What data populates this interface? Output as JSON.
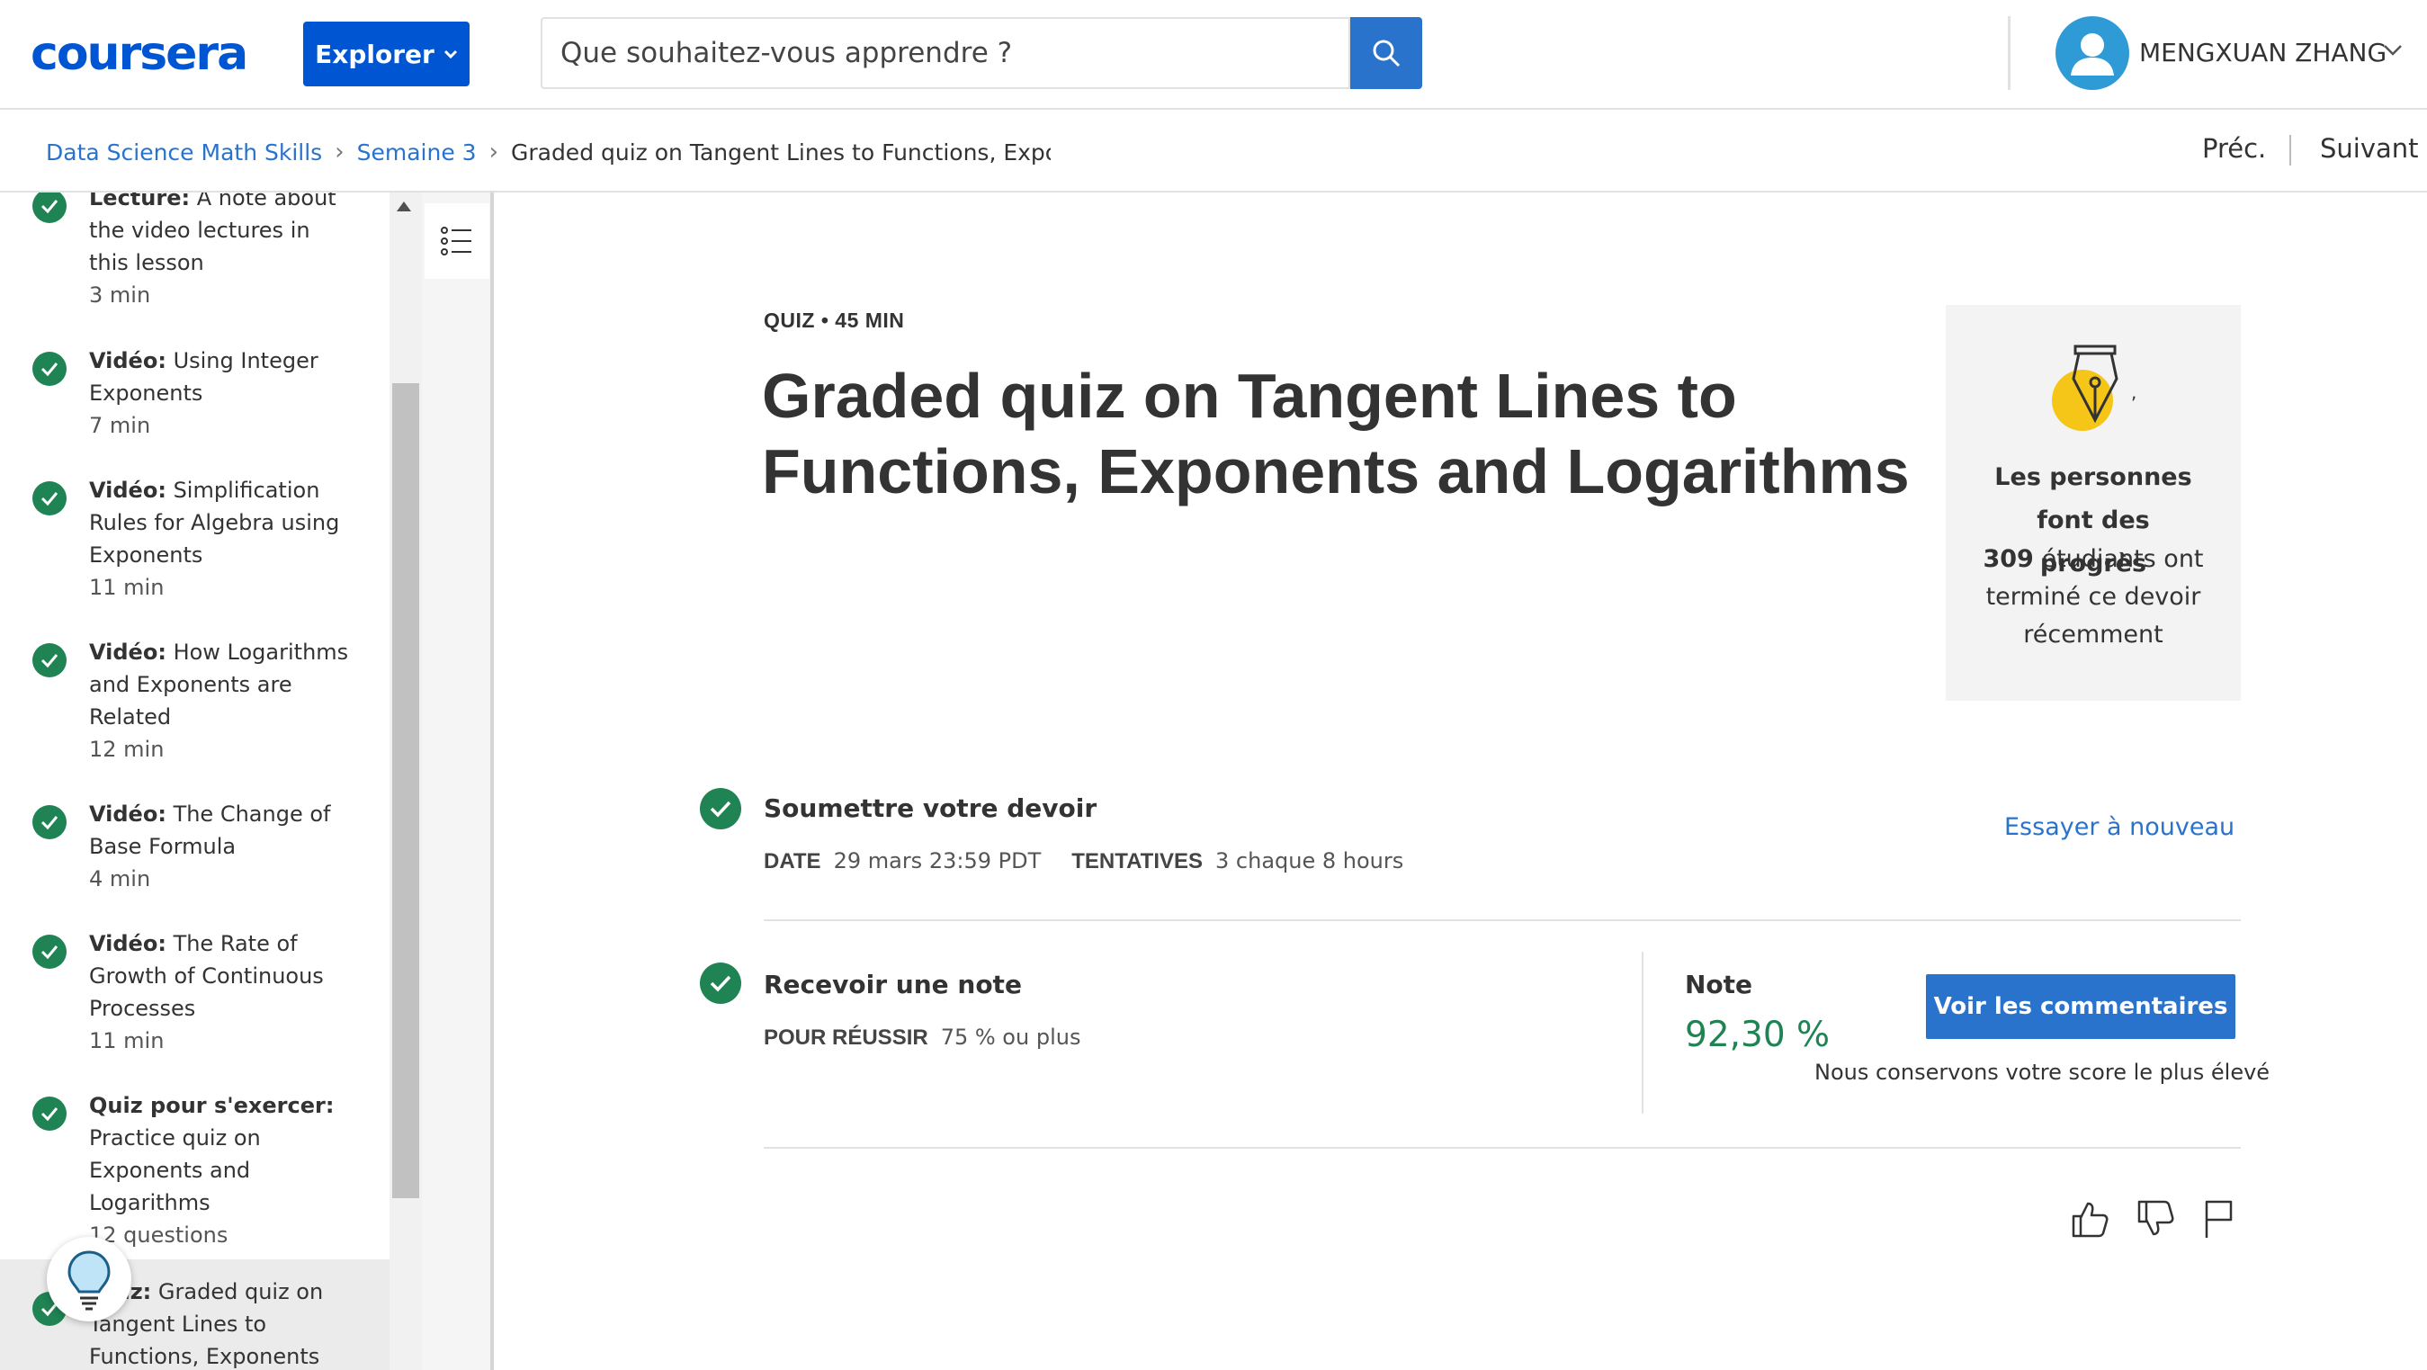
{
  "header": {
    "logo": "coursera",
    "explore_label": "Explorer",
    "search": {
      "placeholder": "Que souhaitez-vous apprendre ?"
    },
    "user_name": "MENGXUAN ZHANG"
  },
  "breadcrumb": {
    "items": [
      "Data Science Math Skills",
      "Semaine 3"
    ],
    "current": "Graded quiz on Tangent Lines to Functions, Exponents and Logarithms",
    "prev_label": "Préc.",
    "next_label": "Suivant"
  },
  "sidebar": {
    "items": [
      {
        "type": "Lecture:",
        "title": "A note about the video lectures in this lesson",
        "duration": "3  min"
      },
      {
        "type": "Vidéo:",
        "title": "Using Integer Exponents",
        "duration": "7  min"
      },
      {
        "type": "Vidéo:",
        "title": "Simplification Rules for Algebra using Exponents",
        "duration": "11  min"
      },
      {
        "type": "Vidéo:",
        "title": "How Logarithms and Exponents are Related",
        "duration": "12  min"
      },
      {
        "type": "Vidéo:",
        "title": "The Change of Base Formula",
        "duration": "4  min"
      },
      {
        "type": "Vidéo:",
        "title": "The Rate of Growth of Continuous Processes",
        "duration": "11  min"
      },
      {
        "type": "Quiz pour s'exercer:",
        "title": "Practice quiz on Exponents and Logarithms",
        "duration": "12 questions"
      },
      {
        "type": "Quiz:",
        "title": "Graded quiz on Tangent Lines to Functions, Exponents",
        "duration": ""
      }
    ]
  },
  "quiz": {
    "meta": "QUIZ • 45  MIN",
    "title": "Graded quiz on Tangent Lines to Functions, Exponents and Logarithms"
  },
  "progress_card": {
    "title": "Les personnes font des progrès",
    "count": "309",
    "text": "étudiants ont terminé ce devoir récemment"
  },
  "submit_step": {
    "title": "Soumettre votre devoir",
    "date_label": "DATE",
    "date_value": "29 mars 23:59 PDT",
    "attempts_label": "TENTATIVES",
    "attempts_value": "3 chaque 8  hours",
    "retry_label": "Essayer à nouveau"
  },
  "grade_step": {
    "title": "Recevoir une note",
    "pass_label": "POUR RÉUSSIR",
    "pass_value": "75 % ou plus",
    "grade_label": "Note",
    "grade_value": "92,30 %",
    "feedback_button": "Voir les commentaires",
    "highest_note": "Nous conservons votre score le plus élevé"
  },
  "colors": {
    "brand": "#0056d2",
    "link": "#2a73cc",
    "success": "#1f8354"
  }
}
